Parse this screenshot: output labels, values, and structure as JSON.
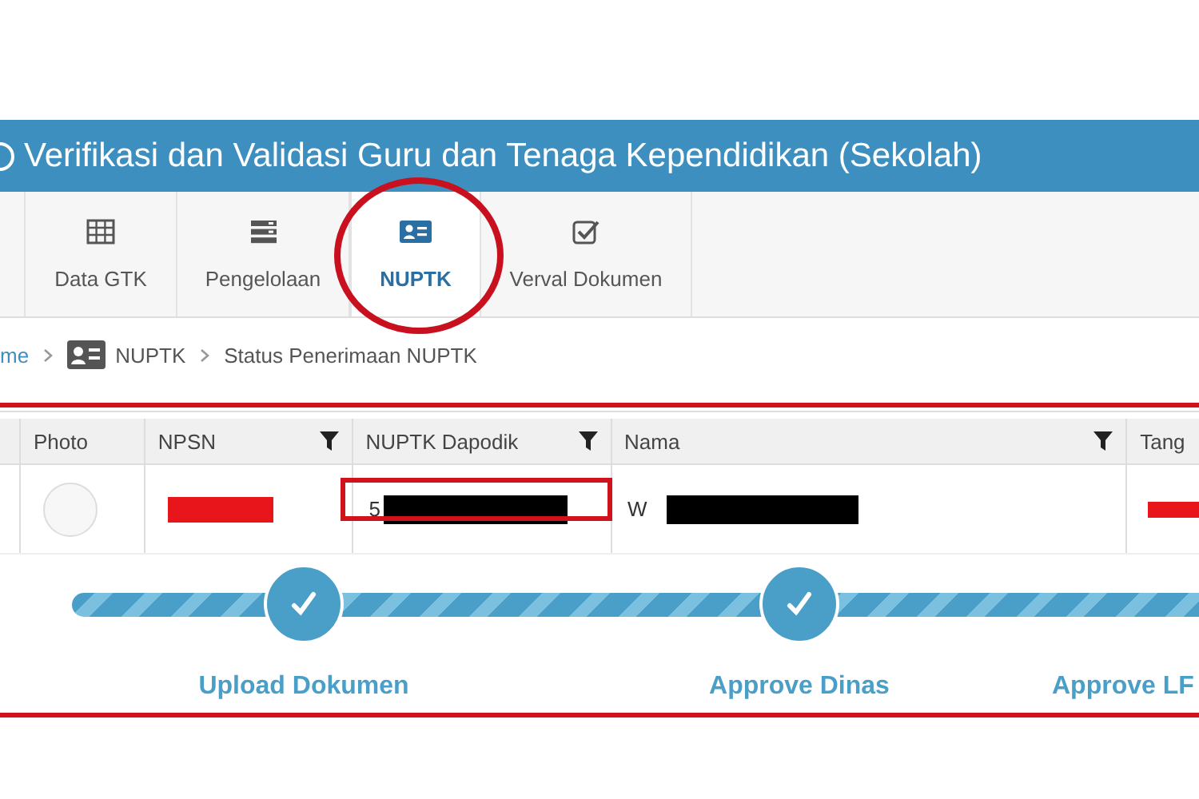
{
  "header": {
    "title": "Verifikasi dan Validasi Guru dan Tenaga Kependidikan (Sekolah)"
  },
  "tabs": [
    {
      "label": "Data GTK",
      "kind": "grid",
      "selected": false
    },
    {
      "label": "Pengelolaan",
      "kind": "list",
      "selected": false
    },
    {
      "label": "NUPTK",
      "kind": "card",
      "selected": true
    },
    {
      "label": "Verval Dokumen",
      "kind": "check",
      "selected": false
    }
  ],
  "breadcrumb": [
    "me",
    "NUPTK",
    "Status Penerimaan NUPTK"
  ],
  "table": {
    "columns": [
      {
        "label": "Photo",
        "filter": false
      },
      {
        "label": "NPSN",
        "filter": true
      },
      {
        "label": "NUPTK Dapodik",
        "filter": true
      },
      {
        "label": "Nama",
        "filter": true
      },
      {
        "label": "Tang"
      }
    ],
    "rows": [
      {
        "nuptk": "5",
        "nama": "W"
      }
    ]
  },
  "steps": [
    {
      "label": "Upload Dokumen",
      "done": true
    },
    {
      "label": "Approve Dinas",
      "done": true
    },
    {
      "label": "Approve LF"
    }
  ]
}
